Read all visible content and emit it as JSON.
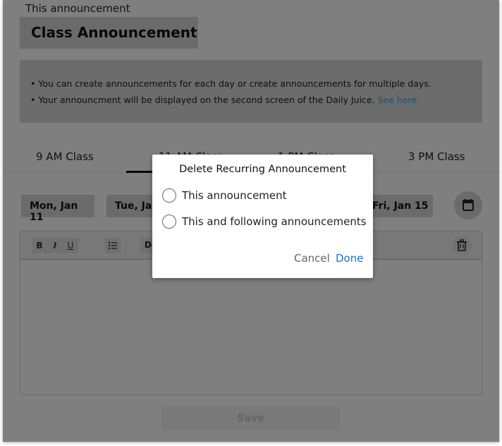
{
  "header": {
    "caption": "This announcement",
    "title": "Class Announcement"
  },
  "info": {
    "line1": "• You can create announcements for each day or create announcements for multiple days.",
    "line2": "• Your announcment will be displayed on the second screen of the Daily Juice.",
    "link": "See here."
  },
  "tabs": [
    {
      "label": "9 AM Class"
    },
    {
      "label": "11 AM Class"
    },
    {
      "label": "1 PM Class"
    },
    {
      "label": "3 PM Class"
    }
  ],
  "days": [
    {
      "label": "Mon, Jan 11"
    },
    {
      "label": "Tue, Jan 12"
    },
    {
      "label": "Fri, Jan 15"
    }
  ],
  "editor": {
    "bold": "B",
    "italic": "I",
    "underline": "U",
    "dropdown": "Default"
  },
  "save_label": "Save",
  "dialog": {
    "title": "Delete Recurring Announcement",
    "option1": "This announcement",
    "option2": "This and following announcements",
    "cancel": "Cancel",
    "done": "Done"
  }
}
